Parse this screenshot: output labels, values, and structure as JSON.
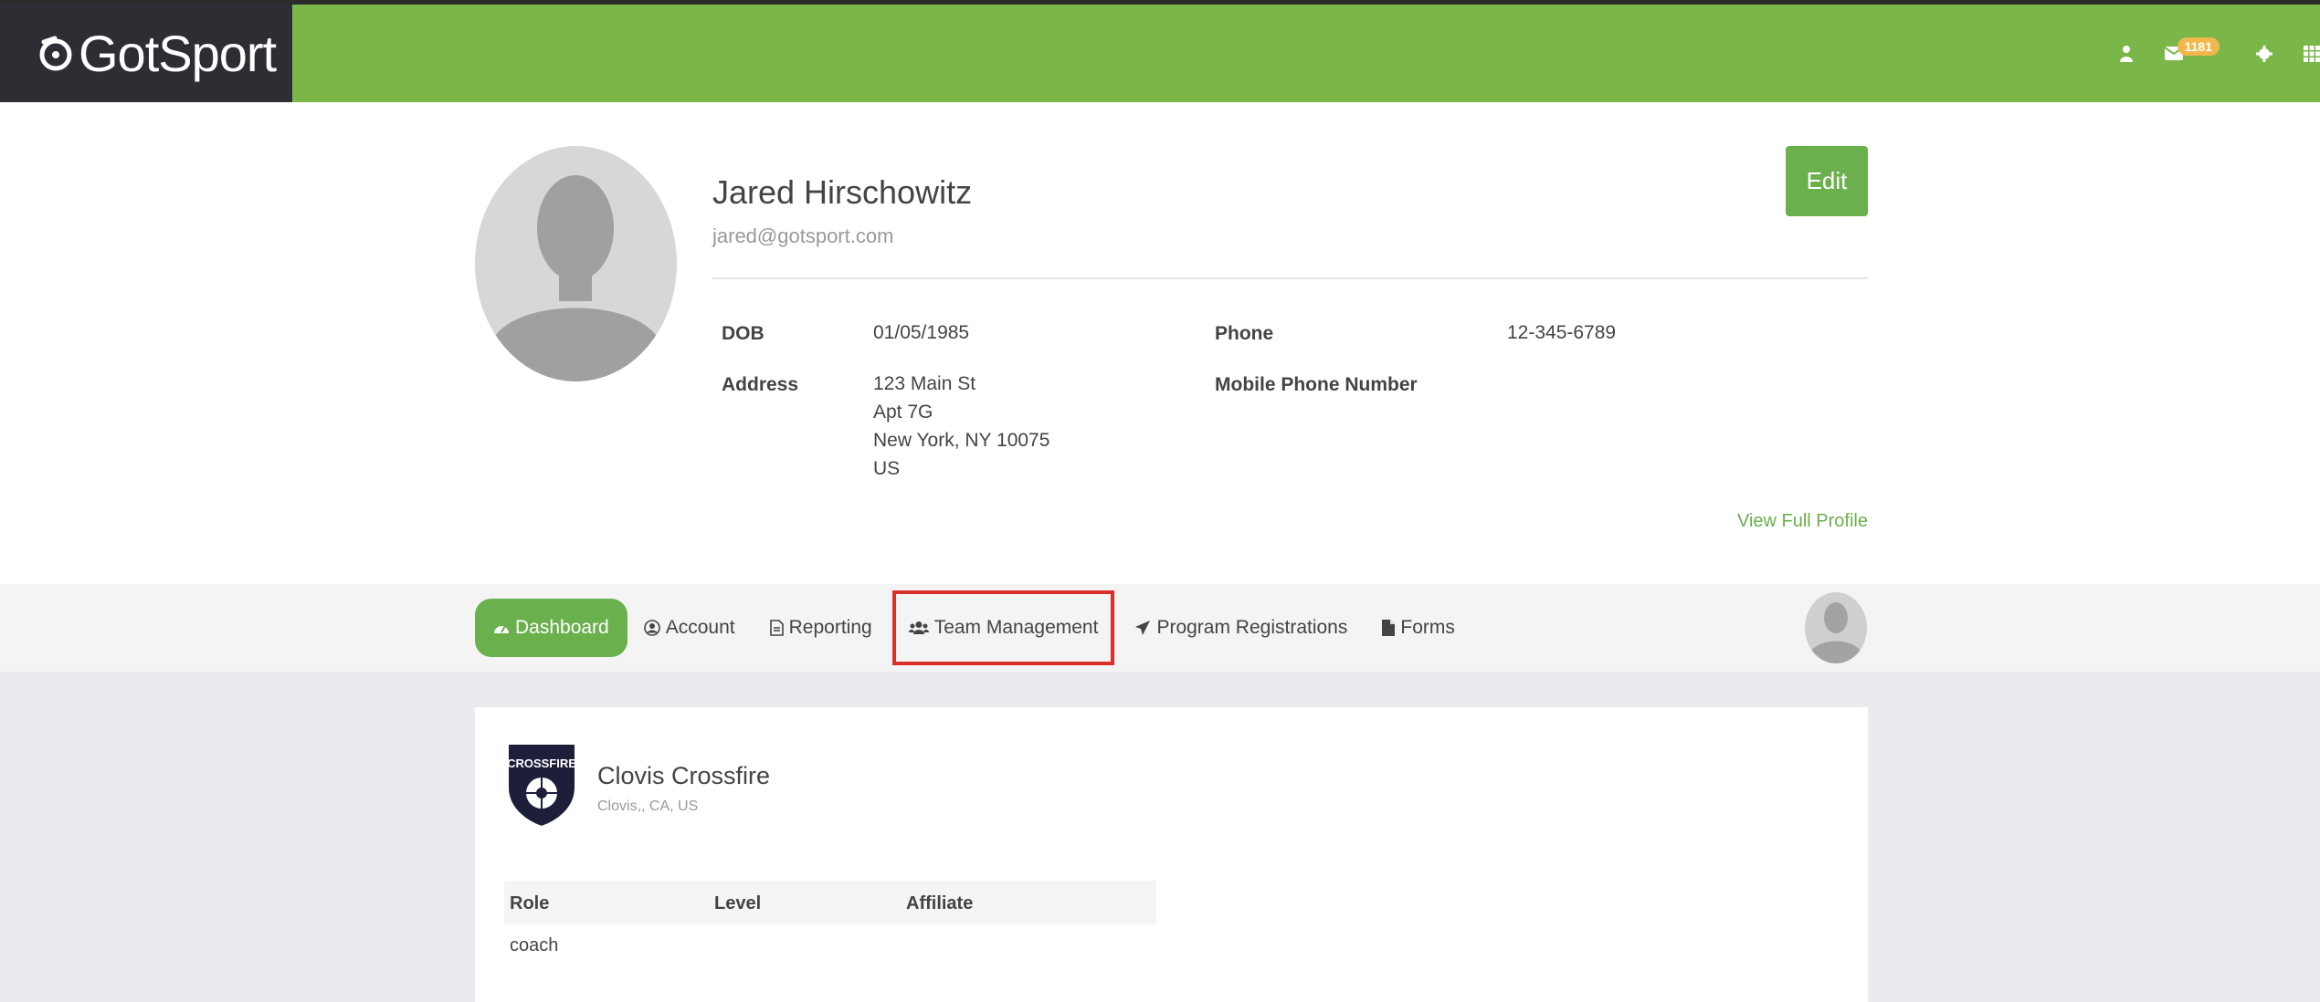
{
  "header": {
    "logo": {
      "part1": "Got",
      "part2": "Sport"
    },
    "icons": [
      "user-icon",
      "envelope-icon",
      "gear-icon",
      "grid-icon"
    ],
    "message_count": "1181",
    "colors": {
      "brand_green": "#7ab648",
      "logo_bg": "#2d2e33",
      "badge": "#f0b84c"
    }
  },
  "profile": {
    "name": "Jared Hirschowitz",
    "email": "jared@gotsport.com",
    "edit_label": "Edit",
    "dob_label": "DOB",
    "dob": "01/05/1985",
    "address_label": "Address",
    "address_lines": [
      "123 Main St",
      "Apt 7G",
      "New York, NY 10075",
      "US"
    ],
    "phone_label": "Phone",
    "phone": "12-345-6789",
    "mobile_label": "Mobile Phone Number",
    "view_full_label": "View Full Profile"
  },
  "nav": {
    "items": [
      {
        "label": "Dashboard",
        "icon": "dashboard-icon",
        "active": true
      },
      {
        "label": "Account",
        "icon": "user-circle-icon"
      },
      {
        "label": "Reporting",
        "icon": "file-text-icon"
      },
      {
        "label": "Team Management",
        "icon": "users-icon",
        "highlighted": true
      },
      {
        "label": "Program Registrations",
        "icon": "paper-plane-icon"
      },
      {
        "label": "Forms",
        "icon": "file-icon"
      }
    ],
    "highlight_color": "#d9302c"
  },
  "club": {
    "name": "Clovis Crossfire",
    "location": "Clovis,, CA, US",
    "crest_text": "CROSSFIRE",
    "table": {
      "headers": [
        "Role",
        "Level",
        "Affiliate"
      ],
      "rows": [
        [
          "coach",
          "",
          ""
        ]
      ]
    }
  }
}
